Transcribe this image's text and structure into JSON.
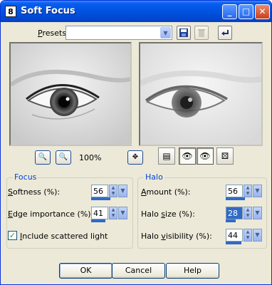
{
  "window": {
    "title": "Soft Focus",
    "app_icon": "8",
    "controls": {
      "minimize": "_",
      "maximize": "□",
      "close": "✕"
    }
  },
  "presets": {
    "label_prefix": "",
    "label_underlined": "P",
    "label_rest": "resets:",
    "value": "",
    "icons": [
      "save-preset-icon",
      "delete-preset-icon",
      "reset-icon"
    ]
  },
  "zoom": {
    "level": "100%"
  },
  "focus": {
    "title": "Focus",
    "softness": {
      "label_u": "S",
      "label_rest": "oftness (%):",
      "value": "56"
    },
    "edge_importance": {
      "label_u": "E",
      "label_rest": "dge importance (%):",
      "value": "41"
    },
    "scattered_light": {
      "label_u": "I",
      "label_rest": "nclude scattered light",
      "checked": true
    }
  },
  "halo": {
    "title": "Halo",
    "amount": {
      "label_u": "A",
      "label_rest": "mount (%):",
      "value": "56"
    },
    "halo_size": {
      "label_pre": "Halo ",
      "label_u": "s",
      "label_rest": "ize (%):",
      "value": "28"
    },
    "halo_visibility": {
      "label_pre": "Halo ",
      "label_u": "v",
      "label_rest": "isibility (%):",
      "value": "44"
    }
  },
  "buttons": {
    "ok": "OK",
    "cancel": "Cancel",
    "help": "Help"
  },
  "colors": {
    "accent": "#316ac5",
    "titlebar": "#0054e3",
    "group_title": "#0046d5",
    "face": "#ece9d8"
  }
}
